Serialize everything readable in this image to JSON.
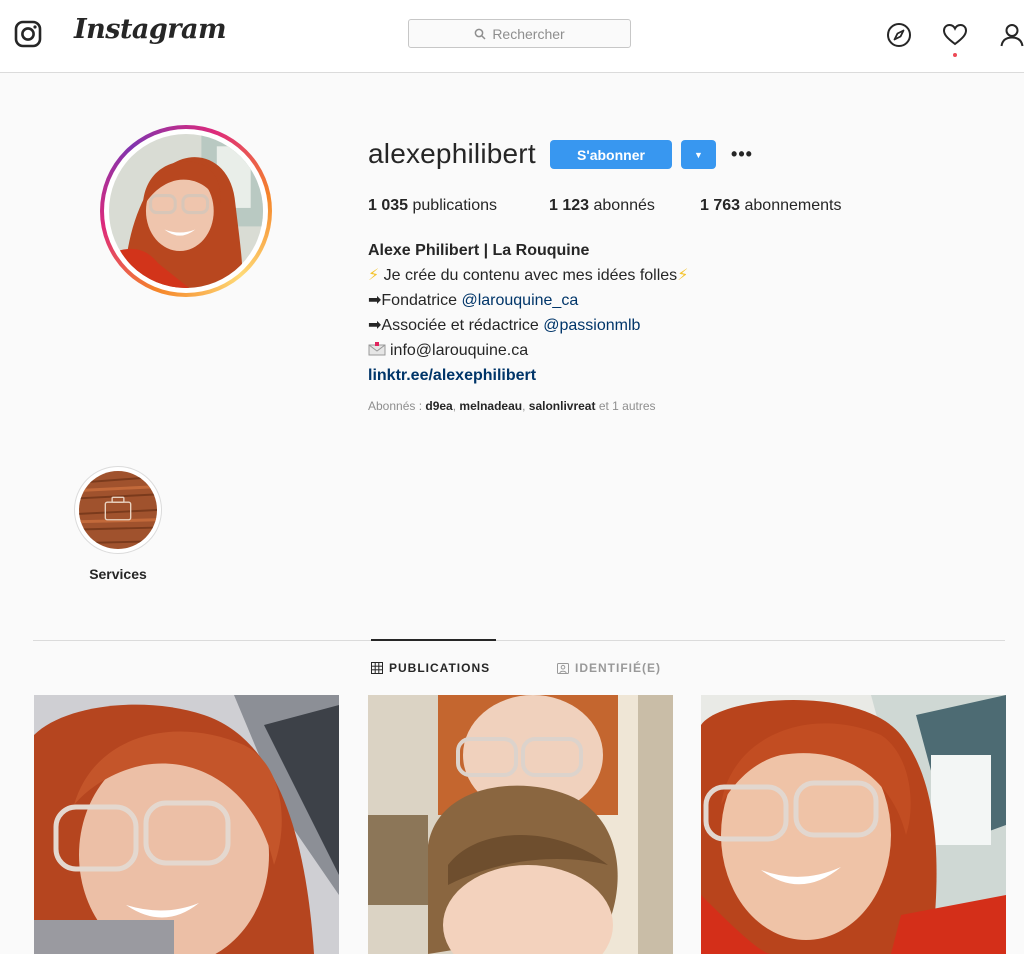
{
  "nav": {
    "brand": "Instagram",
    "search_placeholder": "Rechercher",
    "icons": [
      "instagram-glyph-icon",
      "search-icon",
      "compass-icon",
      "heart-icon",
      "profile-icon"
    ],
    "notification_color": "#ed4956"
  },
  "profile": {
    "username": "alexephilibert",
    "follow_label": "S'abonner",
    "accent_color": "#3897f0",
    "stats": [
      {
        "value": "1 035",
        "label": "publications"
      },
      {
        "value": "1 123",
        "label": "abonnés"
      },
      {
        "value": "1 763",
        "label": "abonnements"
      }
    ],
    "bio": {
      "full_name": "Alexe Philibert | La Rouquine",
      "line1": " Je crée du contenu avec mes idées folles",
      "bolt": "⚡",
      "line2_prefix": "➡Fondatrice ",
      "line2_mention": "@larouquine_ca",
      "line3_prefix": "➡Associée et rédactrice ",
      "line3_mention": "@passionmlb",
      "email": "info@larouquine.ca",
      "link": "linktr.ee/alexephilibert"
    },
    "followed_by": {
      "prefix": "Abonnés : ",
      "user1": "d9ea",
      "user2": "melnadeau",
      "user3": "salonlivreat",
      "suffix": " et 1 autres"
    }
  },
  "highlights": [
    {
      "label": "Services"
    }
  ],
  "tabs": [
    {
      "label": "PUBLICATIONS",
      "active": true
    },
    {
      "label": "IDENTIFIÉ(E)",
      "active": false
    }
  ]
}
